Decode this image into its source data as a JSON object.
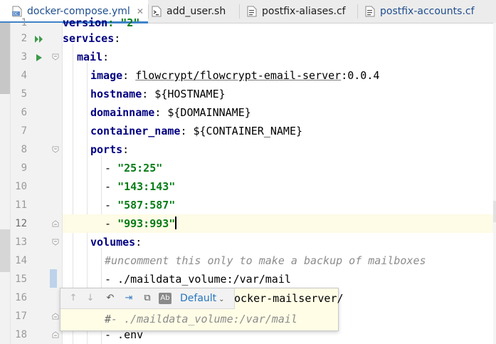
{
  "tabs": [
    {
      "label": "docker-compose.yml",
      "active": true,
      "close": "✕",
      "icon": "yaml-file-icon"
    },
    {
      "label": "add_user.sh",
      "active": false,
      "icon": "shell-file-icon"
    },
    {
      "label": "postfix-aliases.cf",
      "active": false,
      "icon": "text-file-icon"
    },
    {
      "label": "postfix-accounts.cf",
      "active": false,
      "icon": "text-file-icon"
    }
  ],
  "line_numbers": [
    "1",
    "2",
    "3",
    "4",
    "5",
    "6",
    "7",
    "8",
    "9",
    "10",
    "11",
    "12",
    "13",
    "14",
    "15",
    "16",
    "17",
    "18"
  ],
  "current_line": "12",
  "code": {
    "l1": {
      "key": "version",
      "rest": ": \"2\""
    },
    "l2": {
      "key": "services",
      "rest": ":"
    },
    "l3": {
      "key": "mail",
      "rest": ":"
    },
    "l4": {
      "key": "image",
      "sep": ": ",
      "link": "flowcrypt/flowcrypt-email-server",
      "rest": ":0.0.4"
    },
    "l5": {
      "key": "hostname",
      "rest": ": ${HOSTNAME}"
    },
    "l6": {
      "key": "domainname",
      "rest": ": ${DOMAINNAME}"
    },
    "l7": {
      "key": "container_name",
      "rest": ": ${CONTAINER_NAME}"
    },
    "l8": {
      "key": "ports",
      "rest": ":"
    },
    "l9": {
      "dash": "- ",
      "str": "\"25:25\""
    },
    "l10": {
      "dash": "- ",
      "str": "\"143:143\""
    },
    "l11": {
      "dash": "- ",
      "str": "\"587:587\""
    },
    "l12": {
      "dash": "- ",
      "str": "\"993:993\""
    },
    "l13": {
      "key": "volumes",
      "rest": ":"
    },
    "l14": {
      "comment": "#uncomment this only to make a backup of mailboxes"
    },
    "l15": {
      "text": "- ./maildata_volume:/var/mail"
    },
    "l16": {
      "text": "ocker-mailserver/"
    },
    "l18": {
      "text": "- .env"
    }
  },
  "popup": {
    "up_icon": "↑",
    "down_icon": "↓",
    "undo_icon": "↶",
    "merge_icon": "⇥",
    "copy_icon": "⧉",
    "ab_label": "Ab",
    "default_label": "Default",
    "chevron": "⌄",
    "content_hash": "#",
    "content": "- ./maildata_volume:/var/mail"
  }
}
